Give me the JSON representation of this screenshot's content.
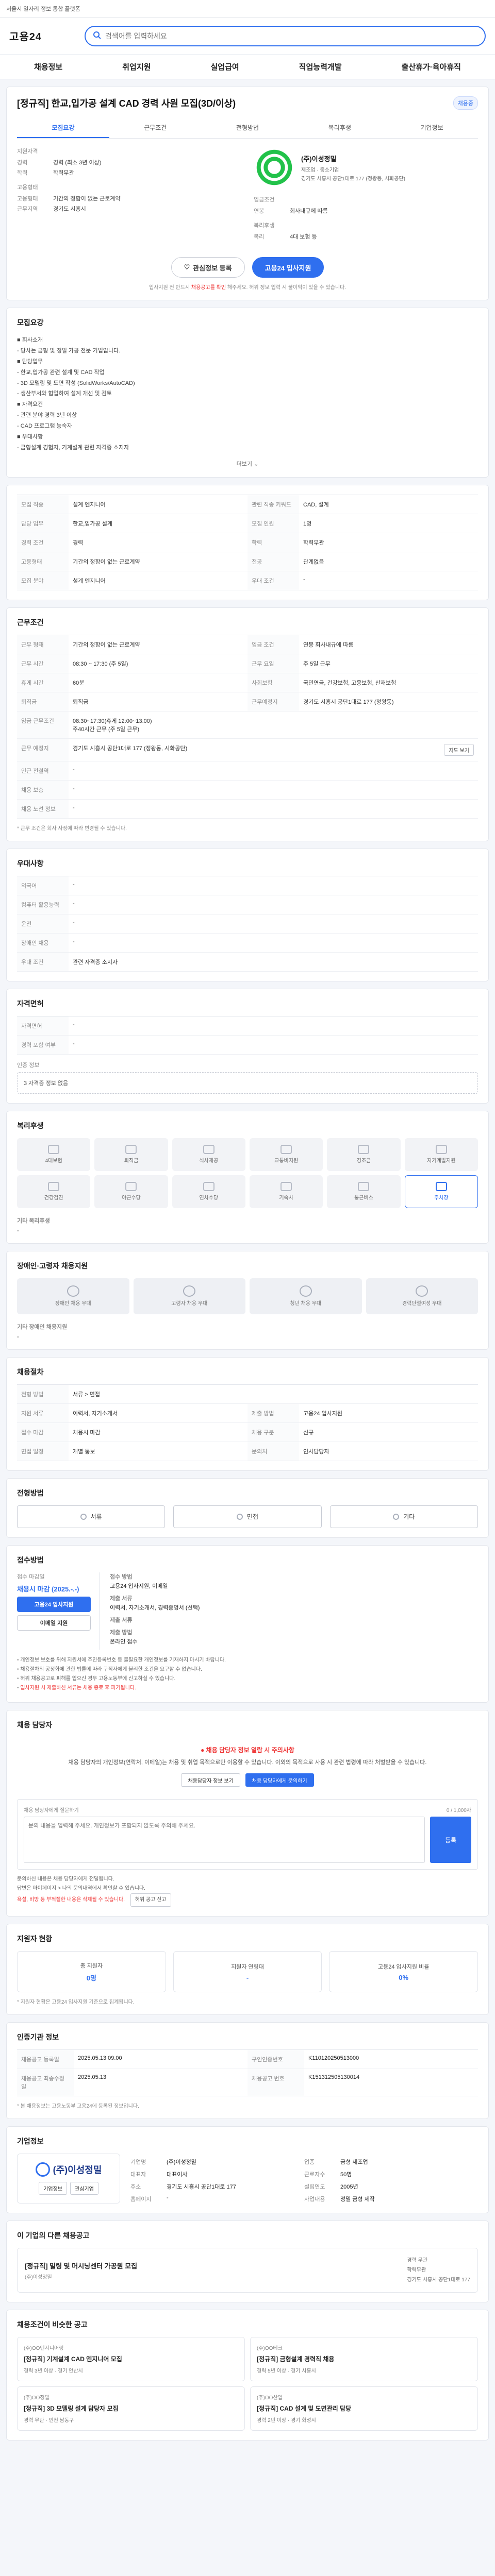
{
  "topbar": {
    "text": "서울시 일자리 정보 통합 플랫폼"
  },
  "header": {
    "logo": "고용24",
    "search_placeholder": "검색어를 입력하세요"
  },
  "nav": [
    "채용정보",
    "취업지원",
    "실업급여",
    "직업능력개발",
    "출산휴가·육아휴직"
  ],
  "summary": {
    "title": "[정규직] 한교,입가공 설계 CAD 경력 사원 모집(3D/이상)",
    "badge": "채용중",
    "tabs": [
      "모집요강",
      "근무조건",
      "전형방법",
      "복리후생",
      "기업정보"
    ],
    "groups": [
      {
        "head": "지원자격",
        "lines": [
          {
            "k": "경력",
            "v": "경력 (최소 3년 이상)"
          },
          {
            "k": "학력",
            "v": "학력무관"
          }
        ]
      },
      {
        "head": "고용형태",
        "lines": [
          {
            "k": "고용형태",
            "v": "기간의 정함이 없는 근로계약"
          },
          {
            "k": "근무지역",
            "v": "경기도 시흥시"
          }
        ]
      }
    ],
    "company": {
      "name": "(주)이성정밀",
      "lines": [
        "제조업 · 중소기업",
        "경기도 시흥시 공단1대로 177 (정왕동, 시화공단)"
      ]
    },
    "right_groups": [
      {
        "head": "임금조건",
        "lines": [
          {
            "k": "연봉",
            "v": "회사내규에 따름"
          }
        ]
      },
      {
        "head": "복리후생",
        "lines": [
          {
            "k": "복리",
            "v": "4대 보험 등"
          }
        ]
      }
    ],
    "buttons": {
      "scrap": "관심정보 등록",
      "apply": "고용24 입사지원"
    },
    "note_prefix": "입사지원 전 반드시",
    "note_red": "채용공고를 확인",
    "note_suffix": "해주세요. 허위 정보 입력 시 불이익이 있을 수 있습니다."
  },
  "recruit": {
    "title": "모집요강",
    "desc": [
      "■ 회사소개",
      "- 당사는 금형 및 정밀 가공 전문 기업입니다.",
      "■ 담당업무",
      "- 한교,입가공 관련 설계 및 CAD 작업",
      "- 3D 모델링 및 도면 작성 (SolidWorks/AutoCAD)",
      "- 생산부서와 협업하여 설계 개선 및 검토",
      "■ 자격요건",
      "- 관련 분야 경력 3년 이상",
      "- CAD 프로그램 능숙자",
      "■ 우대사항",
      "- 금형설계 경험자, 기계설계 관련 자격증 소지자"
    ],
    "more": "더보기 ⌄",
    "table": [
      [
        "모집 직종",
        "설계 엔지니어",
        "관련 직종 키워드",
        "CAD, 설계"
      ],
      [
        "담당 업무",
        "한교,입가공 설계",
        "모집 인원",
        "1명"
      ],
      [
        "경력 조건",
        "경력",
        "학력",
        "학력무관"
      ],
      [
        "고용형태",
        "기간의 정함이 없는 근로계약",
        "전공",
        "관계없음"
      ],
      [
        "모집 분야",
        "설계 엔지니어",
        "우대 조건",
        "-"
      ]
    ]
  },
  "condition": {
    "title": "근무조건",
    "rows": [
      {
        "k": "근무 형태",
        "v": "기간의 정함이 없는 근로계약",
        "k2": "임금 조건",
        "v2": "연봉 회사내규에 따름"
      },
      {
        "k": "근무 시간",
        "v": "08:30 ~ 17:30 (주 5일)",
        "k2": "근무 요일",
        "v2": "주 5일 근무"
      },
      {
        "k": "휴게 시간",
        "v": "60분",
        "k2": "사회보험",
        "v2": "국민연금, 건강보험, 고용보험, 산재보험"
      },
      {
        "k": "퇴직금",
        "v": "퇴직금",
        "k2": "근무예정지",
        "v2": "경기도 시흥시 공단1대로 177 (정왕동)"
      }
    ],
    "wage_extra": "임금 근무조건",
    "wage_detail": [
      "08:30~17:30(휴게 12:00~13:00)",
      "주40시간 근무 (주 5일 근무)"
    ],
    "map_btn": "지도 보기",
    "extra_rows": [
      {
        "k": "근무 예정지",
        "v": "경기도 시흥시 공단1대로 177 (정왕동, 시화공단)"
      },
      {
        "k": "인근 전철역",
        "v": "-"
      },
      {
        "k": "채용 보충",
        "v": "-"
      },
      {
        "k": "채용 노선 정보",
        "v": "-"
      }
    ],
    "notice": "* 근무 조건은 회사 사정에 따라 변경될 수 있습니다."
  },
  "prefer": {
    "title": "우대사항",
    "rows": [
      {
        "k": "외국어",
        "v": "-"
      },
      {
        "k": "컴퓨터 활용능력",
        "v": "-"
      },
      {
        "k": "운전",
        "v": "-"
      },
      {
        "k": "장애인 채용",
        "v": "-"
      },
      {
        "k": "우대 조건",
        "v": "관련 자격증 소지자"
      }
    ]
  },
  "license": {
    "title": "자격면허",
    "rows": [
      {
        "k": "자격면허",
        "v": "-"
      },
      {
        "k": "경력 포함 여부",
        "v": "-"
      }
    ],
    "cert_label": "인증 정보",
    "cert_text": "3 자격증 정보 없음"
  },
  "welfare": {
    "title": "복리후생",
    "items": [
      "4대보험",
      "퇴직금",
      "식사제공",
      "교통비지원",
      "경조금",
      "자기계발지원",
      "건강검진",
      "야근수당",
      "연차수당",
      "기숙사",
      "통근버스",
      "주차장"
    ],
    "active_index": 11,
    "section_title": "기타 복리후생",
    "other": "-"
  },
  "employ": {
    "title": "장애인·고령자 채용지원",
    "items": [
      "장애인 채용 우대",
      "고령자 채용 우대",
      "청년 채용 우대",
      "경력단절여성 우대"
    ],
    "section_title": "기타 장애인 채용지원",
    "other": "-"
  },
  "hire": {
    "title": "채용절차",
    "rows": [
      {
        "k": "전형 방법",
        "v": "서류 > 면접",
        "k2": "",
        "v2": ""
      },
      {
        "k": "지원 서류",
        "v": "이력서, 자기소개서",
        "k2": "제출 방법",
        "v2": "고용24 입사지원"
      },
      {
        "k": "접수 마감",
        "v": "채용시 마감",
        "k2": "채용 구분",
        "v2": "신규"
      },
      {
        "k": "면접 일정",
        "v": "개별 통보",
        "k2": "문의처",
        "v2": "인사담당자"
      }
    ]
  },
  "method": {
    "title": "전형방법",
    "options": [
      "서류",
      "면접",
      "기타"
    ]
  },
  "apply": {
    "title": "접수방법",
    "left_label": "접수 마감일",
    "left_when": "채용시 마감 (2025.-.-)",
    "btn1": "고용24 입사지원",
    "btn2": "이메일 지원",
    "rows": [
      {
        "h": "접수 방법",
        "v": "고용24 입사지원, 이메일"
      },
      {
        "h": "제출 서류",
        "v": "이력서, 자기소개서, 경력증명서 (선택)"
      },
      {
        "h": "제출 서류",
        "v": ""
      },
      {
        "h": "제출 방법",
        "v": "온라인 접수"
      }
    ],
    "bullets": [
      "개인정보 보호를 위해 지원서에 주민등록번호 등 불필요한 개인정보를 기재하지 마시기 바랍니다.",
      "채용절차의 공정화에 관한 법률에 따라 구직자에게 불리한 조건을 요구할 수 없습니다.",
      "허위 채용공고로 피해를 입으신 경우 고용노동부에 신고하실 수 있습니다."
    ],
    "bullet_red": "입사지원 시 제출하신 서류는 채용 종료 후 파기됩니다."
  },
  "qa": {
    "title": "채용 담당자",
    "warn": "● 채용 담당자 정보 열람 시 주의사항",
    "desc": "채용 담당자의 개인정보(연락처, 이메일)는 채용 및 취업 목적으로만 이용할 수 있습니다. 이외의 목적으로 사용 시 관련 법령에 따라 처벌받을 수 있습니다.",
    "btn1": "채용담당자 정보 보기",
    "btn2": "채용 담당자에게 문의하기",
    "form_head": "채용 담당자에게 질문하기",
    "form_right": "0 / 1,000자",
    "placeholder": "문의 내용을 입력해 주세요. 개인정보가 포함되지 않도록 주의해 주세요.",
    "submit": "등록",
    "notes": [
      "문의하신 내용은 채용 담당자에게 전달됩니다.",
      "답변은 마이페이지 > 나의 문의내역에서 확인할 수 있습니다."
    ],
    "notes_red": "욕설, 비방 등 부적절한 내용은 삭제될 수 있습니다.",
    "report_btn": "허위 공고 신고"
  },
  "stats": {
    "title": "지원자 현황",
    "items": [
      {
        "label": "총 지원자",
        "value": "0명"
      },
      {
        "label": "지원자 연령대",
        "value": "-"
      },
      {
        "label": "고용24 입사지원 비율",
        "value": "0%"
      }
    ],
    "note": "* 지원자 현황은 고용24 입사지원 기준으로 집계됩니다."
  },
  "info": {
    "title": "인증기관 정보",
    "rows": [
      {
        "k": "채용공고 등록일",
        "v": "2025.05.13 09:00",
        "k2": "구인인증번호",
        "v2": "K110120250513000"
      },
      {
        "k": "채용공고 최종수정일",
        "v": "2025.05.13",
        "k2": "채용공고 번호",
        "v2": "K151312505130014"
      }
    ],
    "note": "* 본 채용정보는 고용노동부 고용24에 등록된 정보입니다."
  },
  "company": {
    "title": "기업정보",
    "name": "(주)이성정밀",
    "btns": [
      "기업정보",
      "관심기업"
    ],
    "rows": [
      {
        "k": "기업명",
        "v": "(주)이성정밀",
        "k2": "업종",
        "v2": "금형 제조업"
      },
      {
        "k": "대표자",
        "v": "대표이사",
        "k2": "근로자수",
        "v2": "50명"
      },
      {
        "k": "주소",
        "v": "경기도 시흥시 공단1대로 177",
        "k2": "설립연도",
        "v2": "2005년"
      },
      {
        "k": "홈페이지",
        "v": "-",
        "k2": "사업내용",
        "v2": "정밀 금형 제작"
      }
    ]
  },
  "other": {
    "title": "이 기업의 다른 채용공고",
    "job": "[정규직] 밀링 및 머시닝센터 가공원 모집",
    "job_sub": "(주)이성정밀",
    "meta": [
      "경력 무관",
      "학력무관",
      "경기도 시흥시 공단1대로 177"
    ]
  },
  "recommend": {
    "title": "채용조건이 비슷한 공고",
    "items": [
      {
        "co": "(주)OO엔지니어링",
        "tt": "[정규직] 기계설계 CAD 엔지니어 모집",
        "mt": "경력 3년 이상 · 경기 안산시"
      },
      {
        "co": "(주)OO테크",
        "tt": "[정규직] 금형설계 경력직 채용",
        "mt": "경력 5년 이상 · 경기 시흥시"
      },
      {
        "co": "(주)OO정밀",
        "tt": "[정규직] 3D 모델링 설계 담당자 모집",
        "mt": "경력 무관 · 인천 남동구"
      },
      {
        "co": "(주)OO산업",
        "tt": "[정규직] CAD 설계 및 도면관리 담당",
        "mt": "경력 2년 이상 · 경기 화성시"
      }
    ]
  }
}
